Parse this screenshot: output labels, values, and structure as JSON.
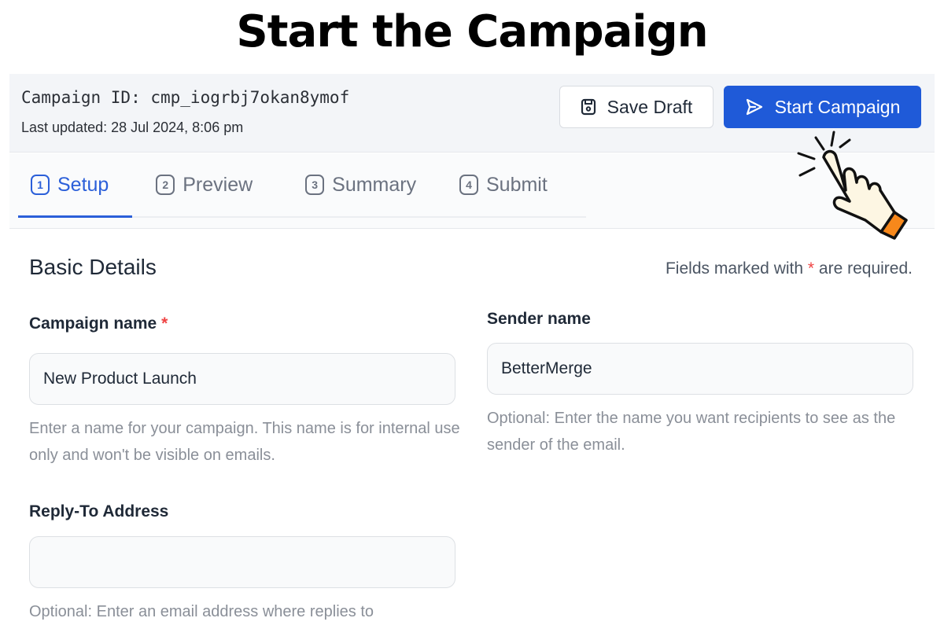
{
  "banner": {
    "title": "Start the Campaign"
  },
  "header": {
    "campaign_id_label": "Campaign ID: cmp_iogrbj7okan8ymof",
    "last_updated": "Last updated: 28 Jul 2024, 8:06 pm",
    "save_draft_label": "Save Draft",
    "start_campaign_label": "Start Campaign",
    "accent_color": "#1f5ad8"
  },
  "tabs": [
    {
      "num": "1",
      "label": "Setup",
      "active": true
    },
    {
      "num": "2",
      "label": "Preview",
      "active": false
    },
    {
      "num": "3",
      "label": "Summary",
      "active": false
    },
    {
      "num": "4",
      "label": "Submit",
      "active": false
    }
  ],
  "form": {
    "section_title": "Basic Details",
    "required_note_prefix": "Fields marked with",
    "required_star": "*",
    "required_note_suffix": "are required.",
    "campaign_name": {
      "label": "Campaign name",
      "required": "*",
      "value": "New Product Launch",
      "help": "Enter a name for your campaign. This name is for internal use only and won't be visible on emails."
    },
    "sender_name": {
      "label": "Sender name",
      "value": "BetterMerge",
      "help": "Optional: Enter the name you want recipients to see as the sender of the email."
    },
    "reply_to": {
      "label": "Reply-To Address",
      "value": "",
      "help": "Optional: Enter an email address where replies to"
    }
  },
  "overlay": {
    "pointer": "hand-pointer-click-icon"
  }
}
